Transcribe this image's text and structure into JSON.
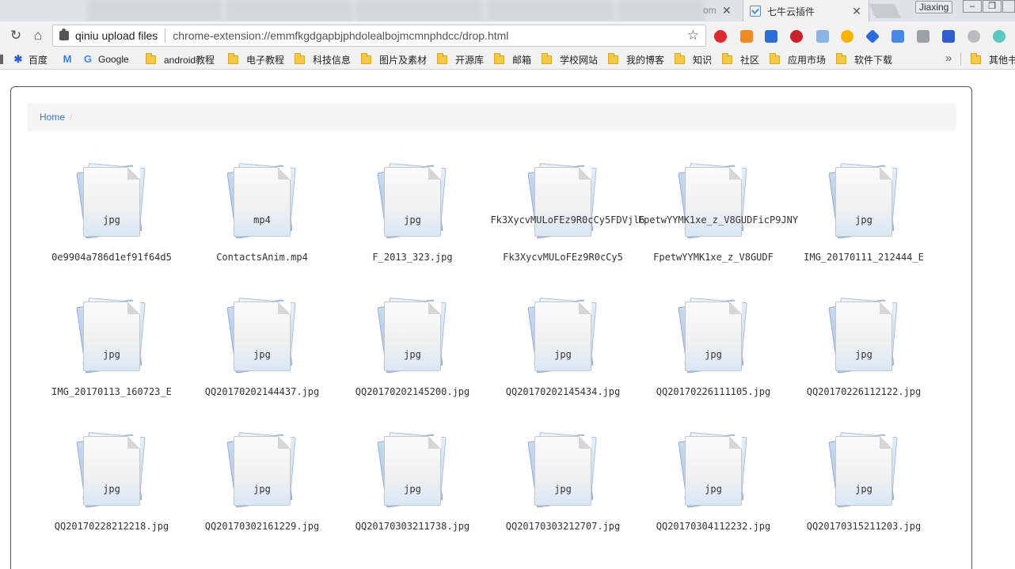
{
  "browser": {
    "active_tab_title": "七牛云插件",
    "partial_tab_text": "om",
    "profile_name": "Jiaxing",
    "site_name": "qiniu upload files",
    "url": "chrome-extension://emmfkgdgapbjphdolealbojmcmnphdcc/drop.html"
  },
  "bookmarks": [
    {
      "label": "百度",
      "kind": "baidu"
    },
    {
      "label": "",
      "kind": "gmail"
    },
    {
      "label": "Google",
      "kind": "google"
    },
    {
      "label": "android教程",
      "kind": "folder"
    },
    {
      "label": "电子教程",
      "kind": "folder"
    },
    {
      "label": "科技信息",
      "kind": "folder"
    },
    {
      "label": "图片及素材",
      "kind": "folder"
    },
    {
      "label": "开源库",
      "kind": "folder"
    },
    {
      "label": "邮箱",
      "kind": "folder"
    },
    {
      "label": "学校网站",
      "kind": "folder"
    },
    {
      "label": "我的博客",
      "kind": "folder"
    },
    {
      "label": "知识",
      "kind": "folder"
    },
    {
      "label": "社区",
      "kind": "folder"
    },
    {
      "label": "应用市场",
      "kind": "folder"
    },
    {
      "label": "软件下载",
      "kind": "folder"
    }
  ],
  "bookmarks_other": "其他书",
  "breadcrumb": {
    "home": "Home",
    "separator": "/"
  },
  "files": [
    {
      "ext": "jpg",
      "name": "0e9904a786d1ef91f64d5"
    },
    {
      "ext": "mp4",
      "name": "ContactsAnim.mp4"
    },
    {
      "ext": "jpg",
      "name": "F_2013_323.jpg"
    },
    {
      "ext": "Fk3XycvMULoFEz9R0cCy5FDVjl6",
      "name": "Fk3XycvMULoFEz9R0cCy5"
    },
    {
      "ext": "FpetwYYMK1xe_z_V8GUDFicP9JNY",
      "name": "FpetwYYMK1xe_z_V8GUDF"
    },
    {
      "ext": "jpg",
      "name": "IMG_20170111_212444_E"
    },
    {
      "ext": "jpg",
      "name": "IMG_20170113_160723_E"
    },
    {
      "ext": "jpg",
      "name": "QQ20170202144437.jpg"
    },
    {
      "ext": "jpg",
      "name": "QQ20170202145200.jpg"
    },
    {
      "ext": "jpg",
      "name": "QQ20170202145434.jpg"
    },
    {
      "ext": "jpg",
      "name": "QQ20170226111105.jpg"
    },
    {
      "ext": "jpg",
      "name": "QQ20170226112122.jpg"
    },
    {
      "ext": "jpg",
      "name": "QQ20170228212218.jpg"
    },
    {
      "ext": "jpg",
      "name": "QQ20170302161229.jpg"
    },
    {
      "ext": "jpg",
      "name": "QQ20170303211738.jpg"
    },
    {
      "ext": "jpg",
      "name": "QQ20170303212707.jpg"
    },
    {
      "ext": "jpg",
      "name": "QQ20170304112232.jpg"
    },
    {
      "ext": "jpg",
      "name": "QQ20170315211203.jpg"
    }
  ],
  "extensions": [
    "opera-icon",
    "weibo-icon",
    "pocket-icon",
    "record-icon",
    "mail-icon",
    "check-icon",
    "shield-icon",
    "translate-icon",
    "gamepad-icon",
    "window-icon",
    "cloud-icon",
    "m-icon"
  ]
}
